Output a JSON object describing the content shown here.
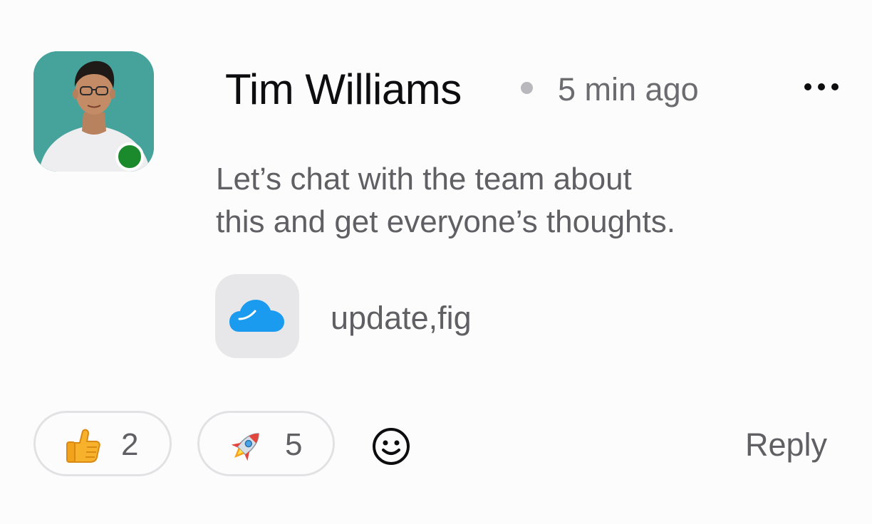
{
  "comment": {
    "author": {
      "name": "Tim Williams",
      "status": "online",
      "avatar_bg": "#45a39c",
      "status_color": "#1b8a2c"
    },
    "timestamp": "5 min ago",
    "menu_icon": "more-horizontal-icon",
    "message_lines": [
      "Let’s chat with the team about",
      "this and get everyone’s thoughts."
    ],
    "attachment": {
      "icon": "cloud-icon",
      "icon_color": "#1a9bf0",
      "file_name": "update,fig"
    },
    "reactions": [
      {
        "emoji": "thumbs-up-icon",
        "count": "2"
      },
      {
        "emoji": "rocket-icon",
        "count": "5"
      }
    ],
    "add_reaction_icon": "smiley-icon",
    "reply_label": "Reply"
  }
}
